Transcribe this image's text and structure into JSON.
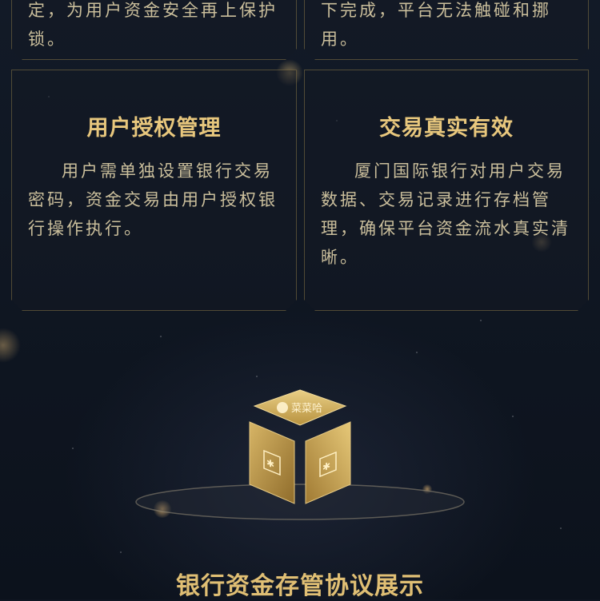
{
  "cards": {
    "top_left": {
      "text": "定，为用户资金安全再上保护锁。"
    },
    "top_right": {
      "text": "下完成，平台无法触碰和挪用。"
    },
    "auth": {
      "title": "用户授权管理",
      "text": "用户需单独设置银行交易密码，资金交易由用户授权银行操作执行。"
    },
    "trade": {
      "title": "交易真实有效",
      "text": "厦门国际银行对用户交易数据、交易记录进行存档管理，确保平台资金流水真实清晰。"
    }
  },
  "cube": {
    "logo_text": "菜菜哈"
  },
  "section_title": "银行资金存管协议展示",
  "colors": {
    "accent_gold": "#e8c77d",
    "background": "#0f1622",
    "text": "#cbbf9c"
  }
}
